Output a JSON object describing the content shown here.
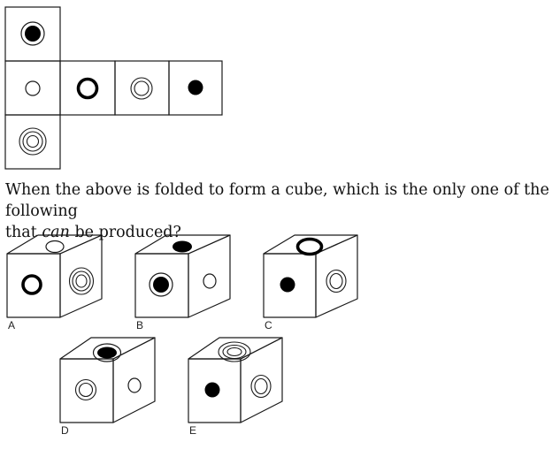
{
  "question": {
    "line1": "When the above is folded to form a cube, which is the only one of the following",
    "line2_before": "that",
    "line2_emphasis": "can",
    "line2_after": "be produced?"
  },
  "net": {
    "squares": [
      {
        "id": "top",
        "symbol": "filled-ringed-circle-icon"
      },
      {
        "id": "left",
        "symbol": "small-circle-icon"
      },
      {
        "id": "center",
        "symbol": "thick-ring-icon"
      },
      {
        "id": "right",
        "symbol": "double-circle-icon"
      },
      {
        "id": "far-right",
        "symbol": "filled-dot-icon"
      },
      {
        "id": "bottom",
        "symbol": "triple-circle-icon"
      }
    ]
  },
  "options": [
    {
      "label": "A",
      "top": "small-circle-icon",
      "front": "thick-ring-icon",
      "side": "triple-circle-icon"
    },
    {
      "label": "B",
      "top": "filled-dot-icon",
      "front": "filled-ringed-circle-icon",
      "side": "small-circle-icon"
    },
    {
      "label": "C",
      "top": "thick-ring-icon",
      "front": "filled-dot-icon",
      "side": "double-circle-icon"
    },
    {
      "label": "D",
      "top": "filled-ringed-circle-icon",
      "front": "double-circle-icon",
      "side": "small-circle-icon"
    },
    {
      "label": "E",
      "top": "triple-circle-icon",
      "front": "filled-dot-icon",
      "side": "double-circle-icon"
    }
  ],
  "colors": {
    "stroke": "#1a1a1a",
    "fill": "#000000",
    "background": "#ffffff"
  }
}
